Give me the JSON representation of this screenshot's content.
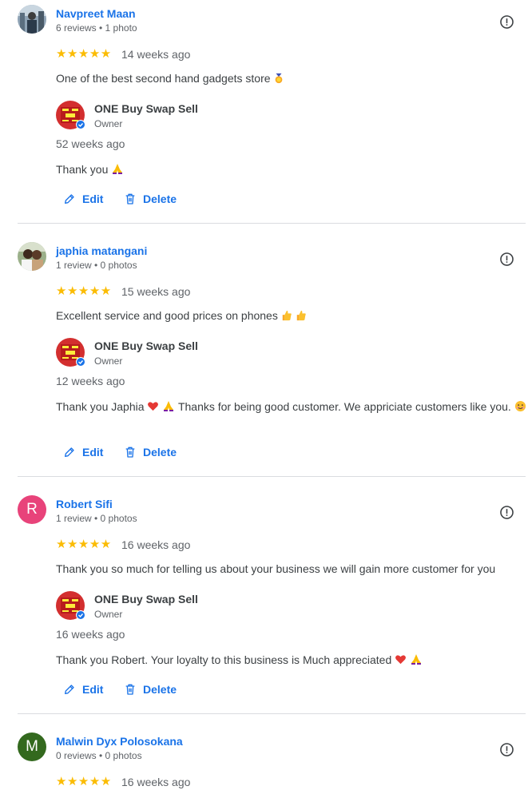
{
  "reviews": [
    {
      "name": "Navpreet Maan",
      "meta": "6 reviews • 1 photo",
      "stars": "★★★★★",
      "date": "14 weeks ago",
      "text": "One of the best second hand gadgets store",
      "owner": {
        "name": "ONE Buy Swap Sell",
        "role": "Owner",
        "date": "52 weeks ago",
        "text": "Thank you"
      },
      "actions": {
        "edit": "Edit",
        "delete": "Delete"
      }
    },
    {
      "name": "japhia matangani",
      "meta": "1 review • 0 photos",
      "stars": "★★★★★",
      "date": "15 weeks ago",
      "text": "Excellent service and good prices on phones",
      "owner": {
        "name": "ONE Buy Swap Sell",
        "role": "Owner",
        "date": "12 weeks ago",
        "text_a": "Thank you Japhia",
        "text_b": "Thanks for being good customer. We appriciate customers like you."
      },
      "actions": {
        "edit": "Edit",
        "delete": "Delete"
      }
    },
    {
      "name": "Robert Sifi",
      "avatar_letter": "R",
      "avatar_color": "#e8437a",
      "meta": "1 review • 0 photos",
      "stars": "★★★★★",
      "date": "16 weeks ago",
      "text": "Thank you so much for telling us about your business we will gain more customer for you",
      "owner": {
        "name": "ONE Buy Swap Sell",
        "role": "Owner",
        "date": "16 weeks ago",
        "text": "Thank you Robert. Your loyalty to this business is Much appreciated"
      },
      "actions": {
        "edit": "Edit",
        "delete": "Delete"
      }
    },
    {
      "name": "Malwin Dyx Polosokana",
      "avatar_letter": "M",
      "avatar_color": "#33691e",
      "meta": "0 reviews • 0 photos",
      "stars": "★★★★★",
      "date": "16 weeks ago"
    }
  ],
  "colors": {
    "accent": "#1a73e8",
    "star": "#fbbc04",
    "muted": "#5f6368",
    "divider": "#dadce0"
  }
}
